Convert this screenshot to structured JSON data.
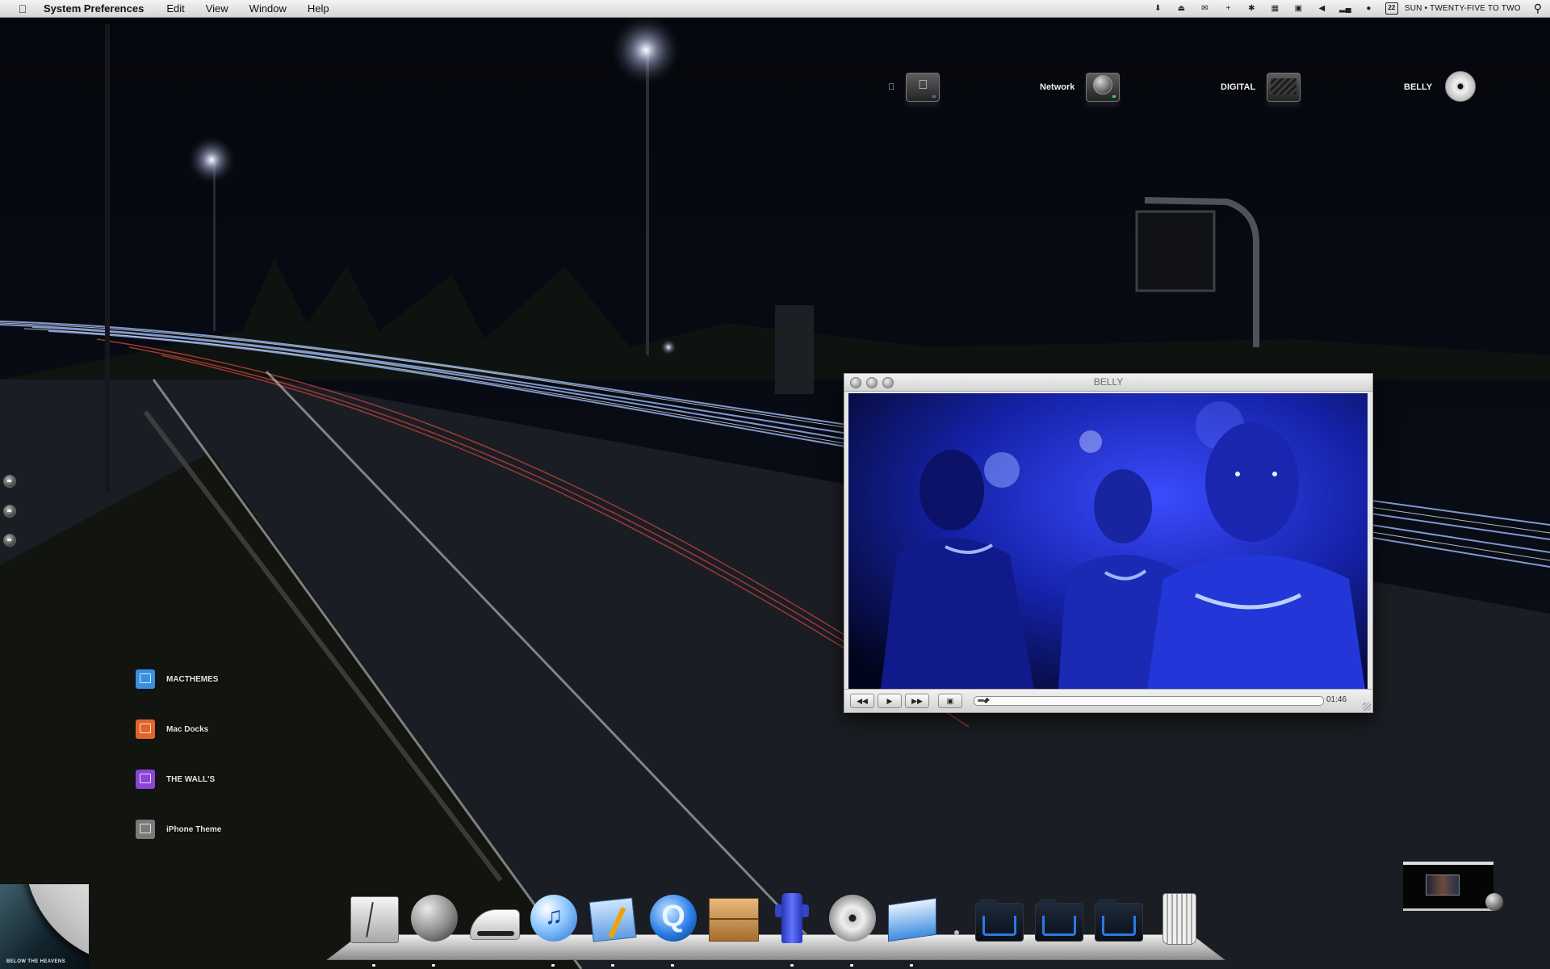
{
  "menubar": {
    "app_name": "System Preferences",
    "menus": [
      "Edit",
      "View",
      "Window",
      "Help"
    ],
    "calendar_day": "22",
    "clock": "SUN • TWENTY-FIVE TO TWO",
    "extras_icons": [
      "download-arrow-icon",
      "eject-icon",
      "mail-icon",
      "plus-icon",
      "bluetooth-icon",
      "keyboard-icon",
      "display-icon",
      "volume-icon",
      "signal-bars-icon",
      "user-icon"
    ]
  },
  "desktop": {
    "drives": [
      {
        "label": "",
        "icon": "apple-hard-drive-icon"
      },
      {
        "label": "Network",
        "icon": "network-globe-icon"
      },
      {
        "label": "DIGITAL",
        "icon": "external-drive-icon"
      },
      {
        "label": "BELLY",
        "icon": "dvd-disc-icon"
      }
    ],
    "shortcuts": [
      {
        "label": "MACTHEMES",
        "color": "#3b8fe0"
      },
      {
        "label": "Mac Docks",
        "color": "#e2642c"
      },
      {
        "label": "THE WALL'S",
        "color": "#8a45d6"
      },
      {
        "label": "iPhone Theme",
        "color": "#7a7a7a"
      }
    ],
    "album_art_text": "BELOW THE HEAVENS"
  },
  "player": {
    "title": "BELLY",
    "time": "01:46",
    "progress": 0.02,
    "buttons": {
      "rewind": "◀◀",
      "play": "▶",
      "forward": "▶▶",
      "screen": "▣"
    }
  },
  "dock": {
    "items": [
      {
        "name": "finder"
      },
      {
        "name": "moon-sphere"
      },
      {
        "name": "sneaker"
      },
      {
        "name": "itunes"
      },
      {
        "name": "blueprint-editor"
      },
      {
        "name": "quicktime"
      },
      {
        "name": "package-box"
      },
      {
        "name": "blue-robot"
      },
      {
        "name": "dvd-player"
      },
      {
        "name": "display-app"
      },
      {
        "name": "folder-1"
      },
      {
        "name": "folder-2"
      },
      {
        "name": "folder-3"
      },
      {
        "name": "trash"
      }
    ]
  },
  "colors": {
    "menubar": "#e3e3e3",
    "wallpaper_sky": "#05070c",
    "light_trail_blue": "#8fb6ff",
    "light_trail_red": "#c74438",
    "video_blue": "#2838ff"
  }
}
